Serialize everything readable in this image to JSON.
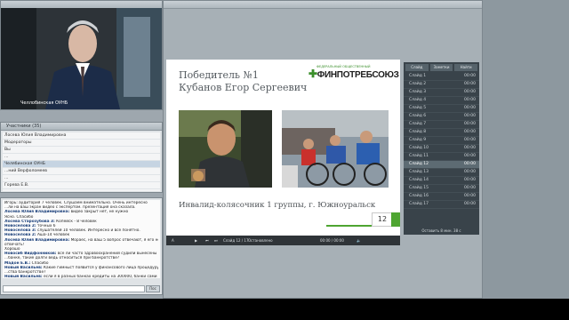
{
  "video": {
    "caption": "Челлобинская ОУНБ"
  },
  "attendees": {
    "title": "Участники (35)",
    "rows": [
      "Лосева Юлия Владимировна",
      "Модераторы",
      "Вы",
      "...",
      "Челябинская ОУНБ",
      "...ний Верфоломеев",
      "...",
      "Горева Е.В."
    ]
  },
  "chat": {
    "lines": [
      {
        "who": "",
        "time": "",
        "text": "Игорь: аудитория 7 человек. Слушаем внимательно. Очень интересно"
      },
      {
        "who": "",
        "time": "",
        "text": "...ли на ваш экран видео с экспертом. презентация она сказала."
      },
      {
        "who": "Лосева Юлия Владимировна:",
        "time": "",
        "text": " видео закрыт нет, не нужно"
      },
      {
        "who": "",
        "time": "",
        "text": "Ясно. Спасибо"
      },
      {
        "who": "Лосева Старозубова 3:",
        "time": "",
        "text": " Копейск - 8 человек"
      },
      {
        "who": "Новоселова 2:",
        "time": "",
        "text": " точных 6"
      },
      {
        "who": "Новоселова 3:",
        "time": "",
        "text": " слушателей 10 человек. Интересно и  всё понятно."
      },
      {
        "who": "Новоселова 2:",
        "time": "",
        "text": " Аша-14 человек"
      },
      {
        "who": "Лосева Юлия Владимировна:",
        "time": "",
        "text": " Мораес, на ваш 5 вопрос отвечают, я его не буду"
      },
      {
        "who": "",
        "time": "",
        "text": "отвечать!"
      },
      {
        "who": "",
        "time": "",
        "text": "Хорошо"
      },
      {
        "who": "Новосиб Видфонников:",
        "time": "",
        "text": " все ли часто здравоохранений судили вынесены решения в"
      },
      {
        "who": "",
        "time": "",
        "text": "...банке, такие долги ведь относиться при банкротстве?"
      },
      {
        "who": "Мадон Е.В.:",
        "time": "",
        "text": " Спасибо"
      },
      {
        "who": "Новый Васильев:",
        "time": "",
        "text": " Какие гимныст появится у финансового лица процедуру"
      },
      {
        "who": "",
        "time": "",
        "text": "...ства банкротстве?"
      },
      {
        "who": "Новый Васильев:",
        "time": "",
        "text": " если я в разных банках кредиты на 300000, банки сами не будут подавать на"
      },
      {
        "who": "",
        "time": "",
        "text": "...ство?"
      }
    ],
    "send_label": "Пос"
  },
  "slide": {
    "title_line1": "Победитель №1",
    "title_line2": "Кубанов Егор Сергеевич",
    "logo_text": "ФИНПОТРЕБСОЮЗ",
    "logo_sub": "ФЕДЕРАЛЬНЫЙ ОБЩЕСТВЕННЫЙ",
    "caption": "Инвалид-колясочник 1 группы, г. Южноуральск",
    "number": "12"
  },
  "player": {
    "play_icon": "play-icon",
    "slide_counter": "Слайд 12 / 17",
    "status": "Остановлено",
    "time": "00:00 / 00:00"
  },
  "slides_panel": {
    "tabs": [
      "Слайд",
      "Заметки",
      "Найти"
    ],
    "rows": [
      {
        "label": "Слайд 1",
        "time": "00:00"
      },
      {
        "label": "Слайд 2",
        "time": "00:00"
      },
      {
        "label": "Слайд 3",
        "time": "00:00"
      },
      {
        "label": "Слайд 4",
        "time": "00:00"
      },
      {
        "label": "Слайд 5",
        "time": "00:00"
      },
      {
        "label": "Слайд 6",
        "time": "00:00"
      },
      {
        "label": "Слайд 7",
        "time": "00:00"
      },
      {
        "label": "Слайд 8",
        "time": "00:00"
      },
      {
        "label": "Слайд 9",
        "time": "00:00"
      },
      {
        "label": "Слайд 10",
        "time": "00:00"
      },
      {
        "label": "Слайд 11",
        "time": "00:00"
      },
      {
        "label": "Слайд 12",
        "time": "00:00"
      },
      {
        "label": "Слайд 13",
        "time": "00:00"
      },
      {
        "label": "Слайд 14",
        "time": "00:00"
      },
      {
        "label": "Слайд 15",
        "time": "00:00"
      },
      {
        "label": "Слайд 16",
        "time": "00:00"
      },
      {
        "label": "Слайд 17",
        "time": "00:00"
      }
    ],
    "current_index": 11,
    "footer": "Оставить 8 мин. 38 с"
  }
}
